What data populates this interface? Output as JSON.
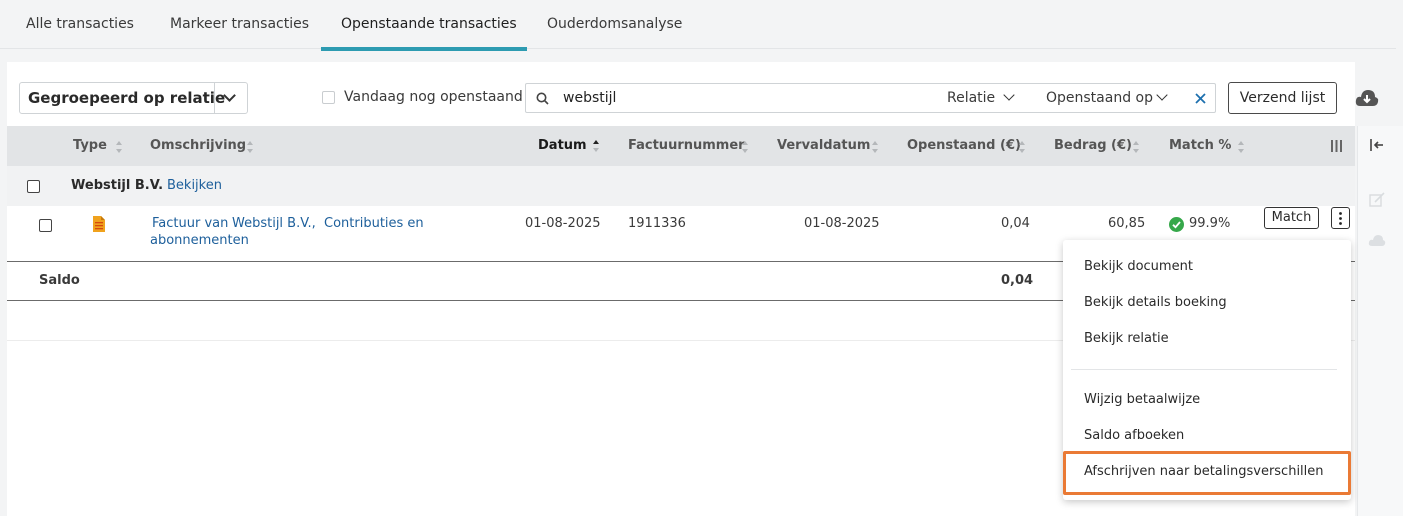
{
  "tabs": [
    {
      "label": "Alle transacties"
    },
    {
      "label": "Markeer transacties"
    },
    {
      "label": "Openstaande transacties",
      "active": true
    },
    {
      "label": "Ouderdomsanalyse"
    }
  ],
  "toolbar": {
    "group_by": "Gegroepeerd op relatie",
    "today_checkbox_label": "Vandaag nog openstaand",
    "search_value": "webstijl",
    "filter_relatie": "Relatie",
    "filter_openstaand": "Openstaand op",
    "send_list_button": "Verzend lijst",
    "accent_color": "#2d9bb1"
  },
  "table": {
    "columns": [
      "Type",
      "Omschrijving",
      "Datum",
      "Factuurnummer",
      "Vervaldatum",
      "Openstaand (€)",
      "Bedrag (€)",
      "Match %"
    ],
    "sorted_column": "Datum",
    "group": {
      "name": "Webstijl B.V.",
      "view_link": "Bekijken"
    },
    "rows": [
      {
        "type_icon": "invoice-document-icon",
        "description_prefix": "Factuur van",
        "description_relation": "Webstijl B.V.,",
        "description_rest1": "Contributies en",
        "description_rest2": "abonnementen",
        "date": "01-08-2025",
        "invoice_number": "1911336",
        "due_date": "01-08-2025",
        "outstanding": "0,04",
        "amount": "60,85",
        "match_percent": "99.9%",
        "match_button": "Match"
      }
    ],
    "total": {
      "label": "Saldo",
      "outstanding": "0,04"
    }
  },
  "context_menu": {
    "items": [
      "Bekijk document",
      "Bekijk details boeking",
      "Bekijk relatie",
      "Wijzig betaalwijze",
      "Saldo afboeken",
      "Afschrijven naar betalingsverschillen"
    ],
    "highlight_color": "#ea7a35"
  }
}
